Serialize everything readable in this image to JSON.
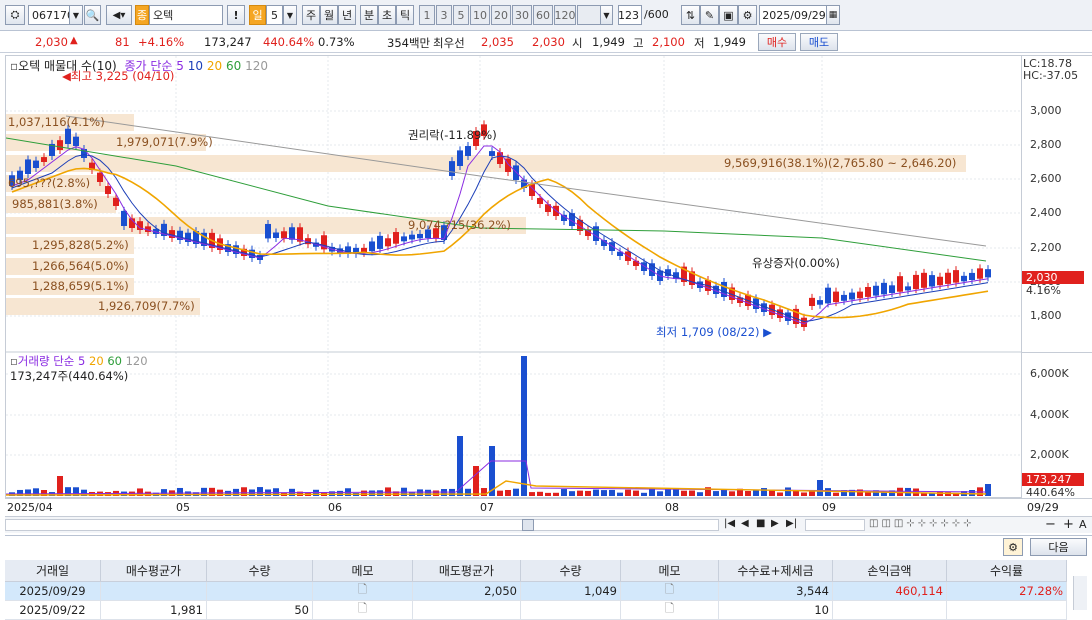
{
  "toolbar": {
    "code": "067170",
    "stock_name": "오텍",
    "stock_tag": "종",
    "period_day": "일",
    "period_num": "5",
    "periods": [
      "주",
      "월",
      "년",
      "분",
      "초",
      "틱"
    ],
    "ticks": [
      "1",
      "3",
      "5",
      "10",
      "20",
      "30",
      "60",
      "120"
    ],
    "count": "123",
    "total": "/600",
    "date": "2025/09/29"
  },
  "quote": {
    "price": "2,030",
    "change": "81",
    "change_pct": "+4.16%",
    "volume": "173,247",
    "volume_ratio": "440.64%",
    "turnover": "0.73%",
    "amount": "354백만",
    "best_label": "최우선",
    "ask": "2,035",
    "bid": "2,030",
    "open_label": "시",
    "open": "1,949",
    "high_label": "고",
    "high": "2,100",
    "low_label": "저",
    "low": "1,949",
    "buy": "매수",
    "sell": "매도"
  },
  "price_chart": {
    "legend_name": "오텍 매물대 수(10)",
    "ma_label": "종가 단순",
    "ma_periods": [
      "5",
      "10",
      "20",
      "60",
      "120"
    ],
    "lc": "LC:18.78",
    "hc": "HC:-37.05",
    "high_note": "최고 3,225 (04/10)",
    "low_note": "최저 1,709 (08/22)",
    "rights_note": "권리락(-11.89%)",
    "capital_note": "유상증자(0.00%)",
    "band_labels": [
      "1,037,116(4.1%)",
      "1,979,071(7.9%)",
      "695,???(2.8%)",
      "985,881(3.8%)",
      "9,569,916(38.1%)(2,765.80 ~ 2,646.20)",
      "9,074,?15(36.2%)",
      "1,295,828(5.2%)",
      "1,266,564(5.0%)",
      "1,288,659(5.1%)",
      "1,926,709(7.7%)"
    ],
    "y_ticks": [
      "3,000",
      "2,800",
      "2,600",
      "2,400",
      "2,200",
      "2,000",
      "1,800"
    ],
    "price_tag": "2,030",
    "pct_tag": "4.16%"
  },
  "volume_chart": {
    "label": "거래량",
    "ma_label": "단순",
    "ma_periods": [
      "5",
      "20",
      "60",
      "120"
    ],
    "current": "173,247주(440.64%)",
    "y_ticks": [
      "6,000K",
      "4,000K",
      "2,000K"
    ],
    "vol_tag": "173,247",
    "pct_tag": "440.64%"
  },
  "x_axis": [
    "2025/04",
    "05",
    "06",
    "07",
    "08",
    "09",
    "09/29"
  ],
  "table": {
    "next": "다음",
    "headers": [
      "거래일",
      "매수평균가",
      "수량",
      "메모",
      "매도평균가",
      "수량",
      "메모",
      "수수료+제세금",
      "손익금액",
      "수익률"
    ],
    "rows": [
      [
        "2025/09/29",
        "",
        "",
        "",
        "2,050",
        "1,049",
        "",
        "3,544",
        "460,114",
        "27.28%"
      ],
      [
        "2025/09/22",
        "1,981",
        "50",
        "",
        "",
        "",
        "",
        "10",
        "",
        ""
      ]
    ]
  },
  "colors": {
    "up": "#e0211d",
    "down": "#1a4fd0",
    "band": "#f7e6d2",
    "ma5": "#8a2be2",
    "ma10": "#1c3fb8",
    "ma20": "#f0a500",
    "ma60": "#2e9e3a",
    "ma120": "#999999"
  }
}
